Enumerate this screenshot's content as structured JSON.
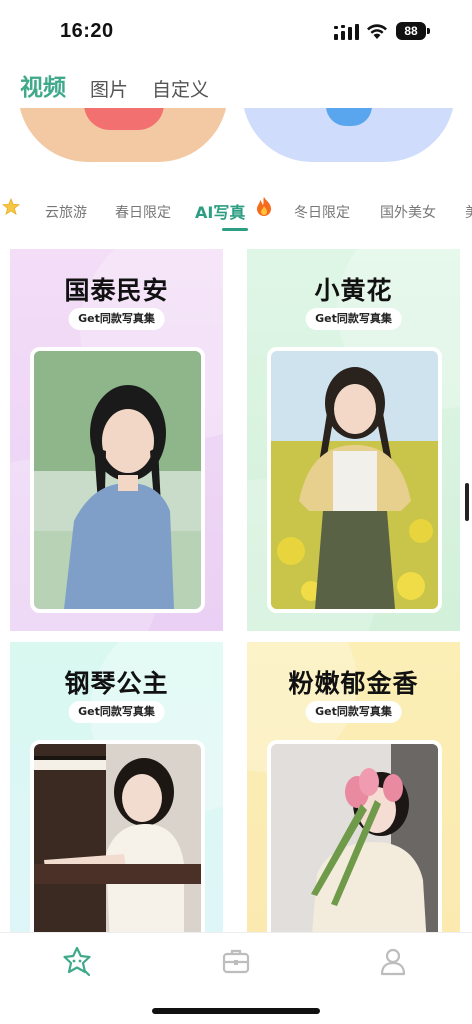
{
  "status_bar": {
    "time": "16:20",
    "battery": "88"
  },
  "top_tabs": [
    {
      "label": "视频",
      "active": true
    },
    {
      "label": "图片",
      "active": false
    },
    {
      "label": "自定义",
      "active": false
    }
  ],
  "categories": [
    {
      "label": "云旅游",
      "active": false
    },
    {
      "label": "春日限定",
      "active": false
    },
    {
      "label": "AI写真",
      "active": true
    },
    {
      "label": "冬日限定",
      "active": false
    },
    {
      "label": "国外美女",
      "active": false
    },
    {
      "label": "美",
      "active": false
    }
  ],
  "cards": [
    {
      "title": "国泰民安",
      "pill": "Get同款写真集"
    },
    {
      "title": "小黄花",
      "pill": "Get同款写真集"
    },
    {
      "title": "钢琴公主",
      "pill": "Get同款写真集"
    },
    {
      "title": "粉嫩郁金香",
      "pill": "Get同款写真集"
    }
  ],
  "bottom_nav": [
    {
      "icon": "star-face-icon",
      "active": true
    },
    {
      "icon": "briefcase-icon",
      "active": false
    },
    {
      "icon": "profile-icon",
      "active": false
    }
  ],
  "colors": {
    "accent": "#3fa98a",
    "tab_active": "#2d9e82"
  }
}
